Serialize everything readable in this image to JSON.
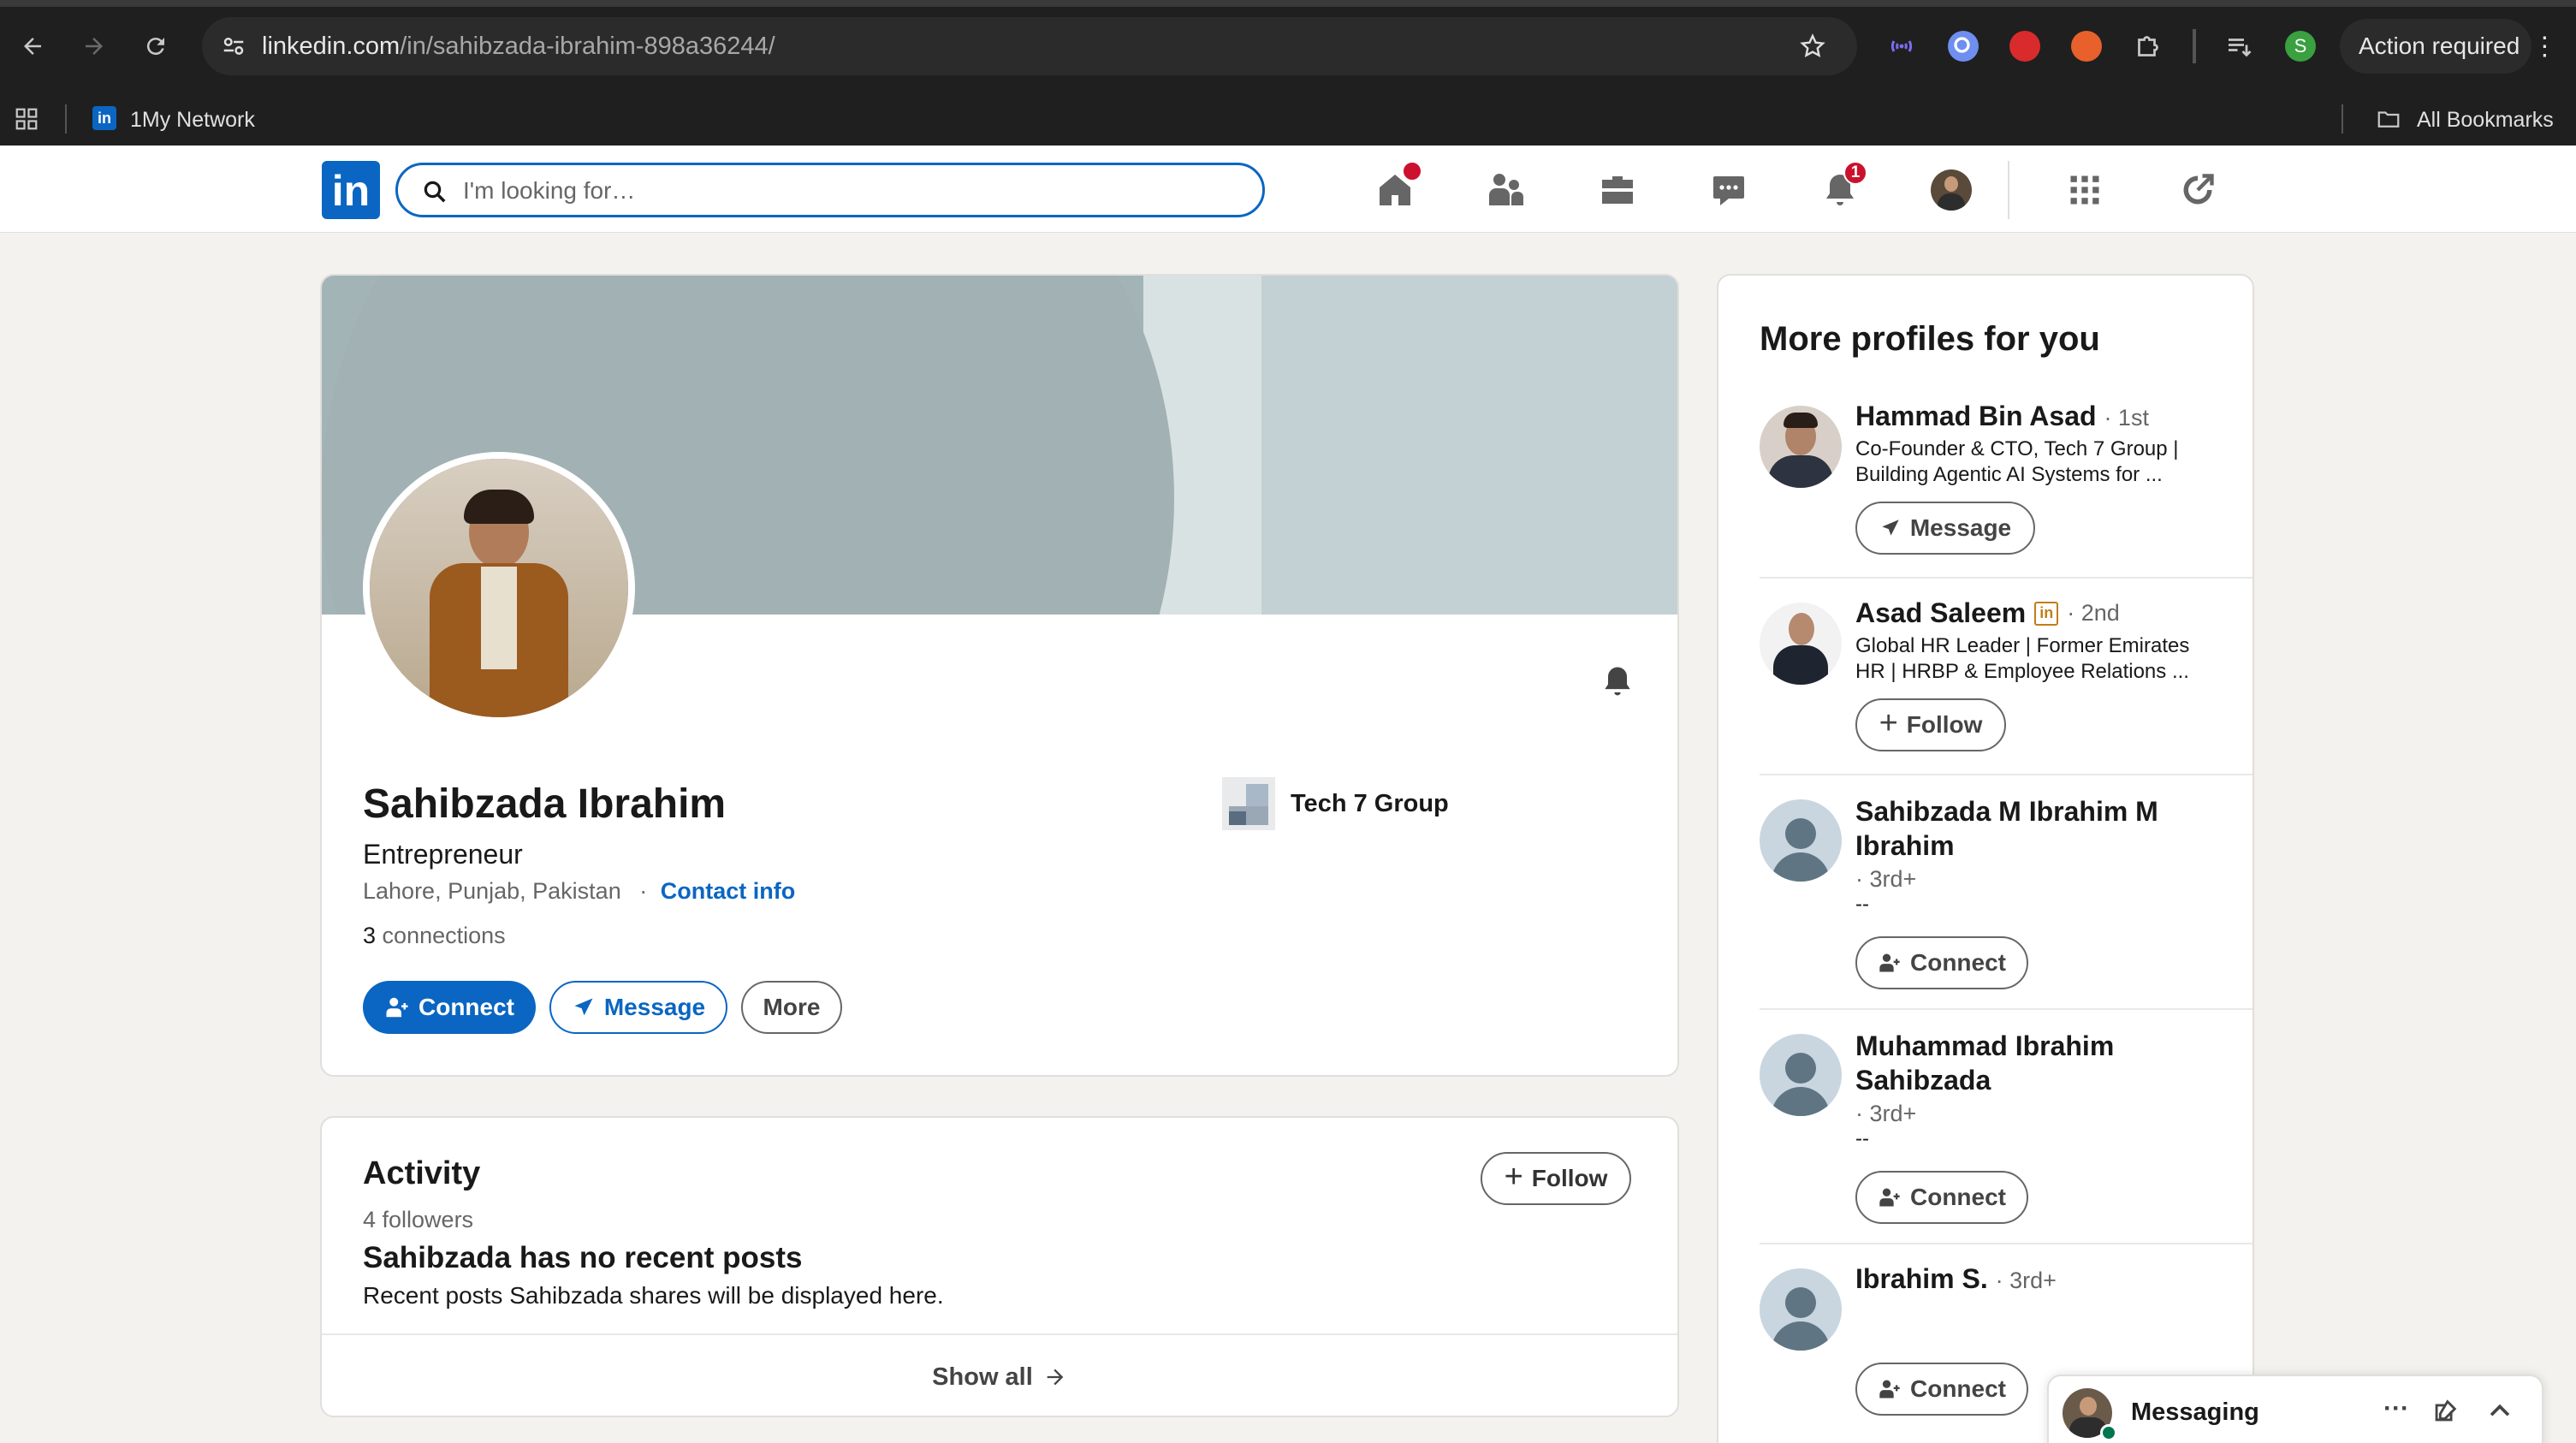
{
  "browser": {
    "url_host": "linkedin.com",
    "url_path": "/in/sahibzada-ibrahim-898a36244/",
    "action_required": "Action required",
    "profile_initial": "S",
    "bookmarks": {
      "item": "1My Network",
      "all": "All Bookmarks"
    }
  },
  "header": {
    "logo": "in",
    "search_placeholder": "I'm looking for…",
    "home_badge": "",
    "notifications_badge": "1"
  },
  "profile": {
    "name": "Sahibzada Ibrahim",
    "headline": "Entrepreneur",
    "location": "Lahore, Punjab, Pakistan",
    "separator": "·",
    "contact_info": "Contact info",
    "connections_count": "3",
    "connections_label": "connections",
    "company": "Tech 7 Group",
    "connect": "Connect",
    "message": "Message",
    "more": "More"
  },
  "activity": {
    "title": "Activity",
    "followers": "4 followers",
    "follow": "Follow",
    "empty_title": "Sahibzada has no recent posts",
    "empty_sub": "Recent posts Sahibzada shares will be displayed here.",
    "show_all": "Show all"
  },
  "rail": {
    "title": "More profiles for you",
    "people": [
      {
        "name": "Hammad Bin Asad",
        "degree": "· 1st",
        "line1": "Co-Founder & CTO, Tech 7 Group |",
        "line2": "Building Agentic AI Systems for ...",
        "action": "Message"
      },
      {
        "name": "Asad Saleem",
        "degree": "· 2nd",
        "line1": "Global HR Leader | Former Emirates",
        "line2": "HR | HRBP & Employee Relations ...",
        "action": "Follow"
      },
      {
        "name_line1": "Sahibzada M Ibrahim M",
        "name_line2": "Ibrahim",
        "degree": "· 3rd+",
        "line1": "--",
        "action": "Connect"
      },
      {
        "name_line1": "Muhammad Ibrahim",
        "name_line2": "Sahibzada",
        "degree": "· 3rd+",
        "line1": "--",
        "action": "Connect"
      },
      {
        "name": "Ibrahim S.",
        "degree": "· 3rd+",
        "action": "Connect"
      }
    ]
  },
  "messaging": {
    "label": "Messaging"
  },
  "colors": {
    "brand": "#0a66c2",
    "badge": "#cb112d"
  }
}
